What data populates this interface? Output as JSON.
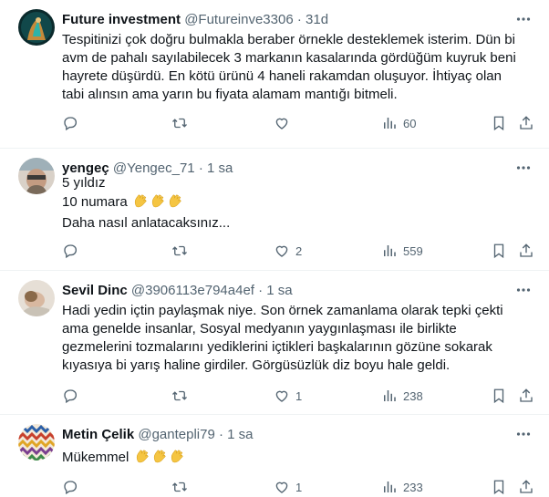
{
  "tweets": [
    {
      "name": "Future investment",
      "handle": "@Futureinve3306",
      "sep": "·",
      "time": "31d",
      "lines": [
        "Tespitinizi çok doğru bulmakla beraber örnekle desteklemek isterim. Dün bi",
        "avm de pahalı sayılabilecek 3 markanın kasalarında gördüğüm kuyruk beni",
        "hayrete düşürdü. En kötü ürünü 4 haneli rakamdan oluşuyor. İhtiyaç olan",
        "tabi alınsın ama yarın bu fiyata alamam mantığı bitmeli."
      ],
      "reply_count": "",
      "retweet_count": "",
      "like_count": "",
      "view_count": "60"
    },
    {
      "name": "yengeç",
      "handle": "@Yengec_71",
      "sep": "·",
      "time": "1 sa",
      "lines": [
        "5 yıldız",
        "10 numara",
        "Daha nasıl anlatacaksınız..."
      ],
      "reply_count": "",
      "retweet_count": "",
      "like_count": "2",
      "view_count": "559"
    },
    {
      "name": "Sevil Dinc",
      "handle": "@3906113e794a4ef",
      "sep": "·",
      "time": "1 sa",
      "lines": [
        "Hadi yedin içtin paylaşmak niye. Son örnek zamanlama olarak tepki çekti",
        "ama genelde insanlar, Sosyal medyanın yaygınlaşması ile birlikte",
        "gezmelerini tozmalarını yediklerini içtikleri başkalarının gözüne sokarak",
        "kıyasıya bi yarış haline girdiler. Görgüsüzlük diz boyu hale geldi."
      ],
      "reply_count": "",
      "retweet_count": "",
      "like_count": "1",
      "view_count": "238"
    },
    {
      "name": "Metin Çelik",
      "handle": "@gantepli79",
      "sep": "·",
      "time": "1 sa",
      "lines": [
        "Mükemmel"
      ],
      "reply_count": "",
      "retweet_count": "",
      "like_count": "1",
      "view_count": "233"
    }
  ],
  "icons": {
    "more": "more-icon",
    "reply": "reply-icon",
    "retweet": "retweet-icon",
    "like": "like-icon",
    "views": "views-icon",
    "bookmark": "bookmark-icon",
    "share": "share-icon",
    "emoji": "clapping-hands-emoji"
  },
  "colors": {
    "text": "#0f1419",
    "secondary": "#536471",
    "divider": "#eff3f4",
    "clap": "#f5c542"
  }
}
